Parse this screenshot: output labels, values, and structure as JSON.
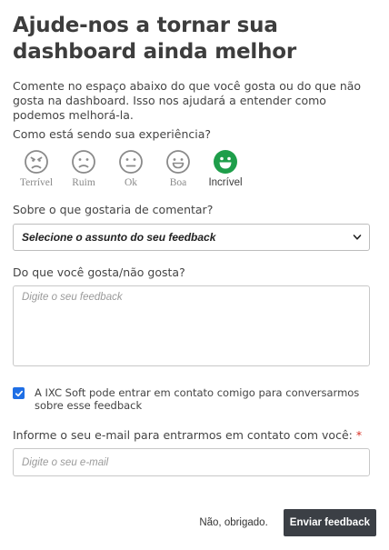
{
  "title": "Ajude-nos a tornar sua dashboard ainda melhor",
  "intro": "Comente no espaço abaixo do que você gosta ou do que não gosta na dashboard. Isso nos ajudará a entender como podemos melhorá-la.",
  "experience": {
    "question": "Como está sendo sua experiência?",
    "options": [
      {
        "label": "Terrível",
        "icon": "angry-face-icon",
        "selected": false
      },
      {
        "label": "Ruim",
        "icon": "sad-face-icon",
        "selected": false
      },
      {
        "label": "Ok",
        "icon": "neutral-face-icon",
        "selected": false
      },
      {
        "label": "Boa",
        "icon": "smile-face-icon",
        "selected": false
      },
      {
        "label": "Incrível",
        "icon": "grin-face-icon",
        "selected": true
      }
    ],
    "selected_color": "#1e9e4a",
    "unselected_color": "#8a8a8a"
  },
  "topic": {
    "question": "Sobre o que gostaria de comentar?",
    "selected_value": "Selecione o assunto do seu feedback"
  },
  "like": {
    "question": "Do que você gosta/não gosta?",
    "placeholder": "Digite o seu feedback"
  },
  "consent": {
    "checked": true,
    "text": "A IXC Soft pode entrar em contato comigo para conversarmos sobre esse feedback"
  },
  "email": {
    "question": "Informe o seu e-mail para entrarmos em contato com você:",
    "required_mark": "*",
    "placeholder": "Digite o seu e-mail"
  },
  "footer": {
    "dismiss_label": "Não, obrigado.",
    "submit_label": "Enviar feedback"
  }
}
